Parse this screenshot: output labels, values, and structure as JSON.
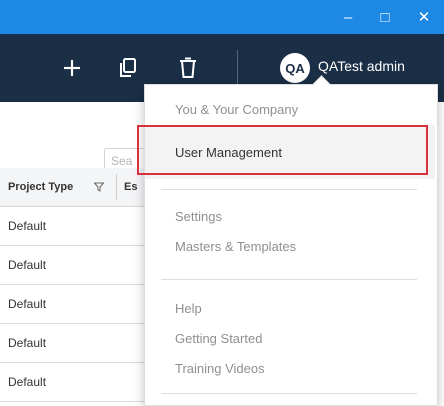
{
  "window": {
    "minimize_glyph": "–",
    "maximize_glyph": "□",
    "close_glyph": "✕"
  },
  "toolbar": {
    "icons": [
      "plus-icon",
      "copy-icon",
      "trash-icon"
    ],
    "user": {
      "initials": "QA",
      "name": "QATest admin"
    }
  },
  "search": {
    "placeholder": "Sea"
  },
  "grid": {
    "columns": [
      "Project Type",
      "Es"
    ],
    "rows": [
      "Default",
      "Default",
      "Default",
      "Default",
      "Default"
    ]
  },
  "menu": {
    "items": [
      "You & Your Company",
      "User Management",
      "Settings",
      "Masters & Templates",
      "Help",
      "Getting Started",
      "Training Videos"
    ],
    "highlighted_item": "User Management"
  },
  "colors": {
    "titlebar": "#1e88e5",
    "toolbar": "#1a2e45",
    "highlight_border": "#d9303a"
  }
}
